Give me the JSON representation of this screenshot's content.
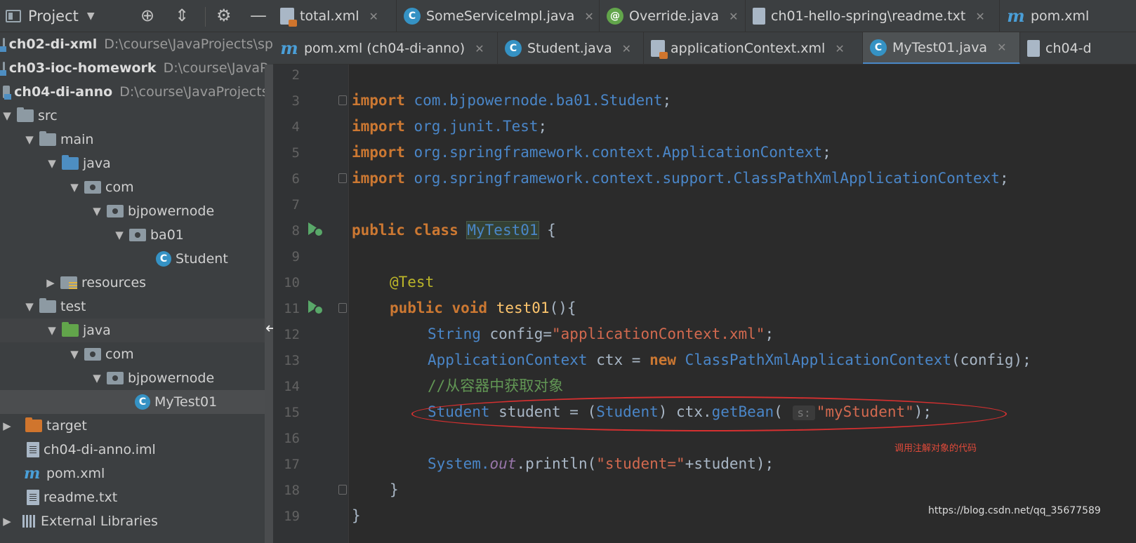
{
  "project_panel": {
    "title": "Project",
    "tree": [
      {
        "label": "ch02-di-xml",
        "path": "D:\\course\\JavaProjects\\sp",
        "icon": "module-icon",
        "indent": 0,
        "bold": true
      },
      {
        "label": "ch03-ioc-homework",
        "path": "D:\\course\\JavaPr",
        "icon": "module-icon",
        "indent": 0,
        "bold": true
      },
      {
        "label": "ch04-di-anno",
        "path": "D:\\course\\JavaProjects\\",
        "icon": "module-icon",
        "indent": 0,
        "bold": true
      },
      {
        "label": "src",
        "icon": "folder-icon",
        "indent": 0
      },
      {
        "label": "main",
        "icon": "folder-icon",
        "indent": 1
      },
      {
        "label": "java",
        "icon": "source-folder-icon",
        "indent": 2
      },
      {
        "label": "com",
        "icon": "package-icon",
        "indent": 3
      },
      {
        "label": "bjpowernode",
        "icon": "package-icon",
        "indent": 4
      },
      {
        "label": "ba01",
        "icon": "package-icon",
        "indent": 5
      },
      {
        "label": "Student",
        "icon": "class-icon",
        "indent": 6
      },
      {
        "label": "resources",
        "icon": "resources-folder-icon",
        "indent": 1
      },
      {
        "label": "test",
        "icon": "folder-icon",
        "indent": 0
      },
      {
        "label": "java",
        "icon": "test-folder-icon",
        "indent": 1
      },
      {
        "label": "com",
        "icon": "package-icon",
        "indent": 2
      },
      {
        "label": "bjpowernode",
        "icon": "package-icon",
        "indent": 3
      },
      {
        "label": "MyTest01",
        "icon": "test-class-icon",
        "indent": 4
      },
      {
        "label": "target",
        "icon": "excluded-folder-icon",
        "indent": 0
      },
      {
        "label": "ch04-di-anno.iml",
        "icon": "iml-file-icon",
        "indent": 0
      },
      {
        "label": "pom.xml",
        "icon": "maven-icon",
        "indent": 0
      },
      {
        "label": "readme.txt",
        "icon": "text-file-icon",
        "indent": 0
      },
      {
        "label": "External Libraries",
        "icon": "libraries-icon",
        "indent": 0
      }
    ]
  },
  "tabs_row1": [
    {
      "label": "total.xml",
      "icon": "xml-icon"
    },
    {
      "label": "SomeServiceImpl.java",
      "icon": "class-icon"
    },
    {
      "label": "Override.java",
      "icon": "annotation-icon"
    },
    {
      "label": "ch01-hello-spring\\readme.txt",
      "icon": "text-file-icon"
    },
    {
      "label": "pom.xml",
      "icon": "maven-icon"
    }
  ],
  "tabs_row2": [
    {
      "label": "pom.xml (ch04-di-anno)",
      "icon": "maven-icon"
    },
    {
      "label": "Student.java",
      "icon": "class-icon"
    },
    {
      "label": "applicationContext.xml",
      "icon": "xml-icon"
    },
    {
      "label": "MyTest01.java",
      "icon": "class-icon",
      "active": true
    },
    {
      "label": "ch04-d",
      "icon": "text-file-icon"
    }
  ],
  "editor": {
    "line_numbers": [
      "2",
      "3",
      "4",
      "5",
      "6",
      "7",
      "8",
      "9",
      "10",
      "11",
      "12",
      "13",
      "14",
      "15",
      "16",
      "17",
      "18",
      "19"
    ],
    "code": {
      "l3_kw": "import",
      "l3_pkg": " com.bjpowernode.ba01.",
      "l3_cls": "Student",
      "l3_end": ";",
      "l4_kw": "import",
      "l4_pkg": " org.junit.",
      "l4_cls": "Test",
      "l4_end": ";",
      "l5_kw": "import",
      "l5_pkg": " org.springframework.context.",
      "l5_cls": "ApplicationContext",
      "l5_end": ";",
      "l6_kw": "import",
      "l6_pkg": " org.springframework.context.support.",
      "l6_cls": "ClassPathXmlApplicationContext",
      "l6_end": ";",
      "l8_kw": "public class ",
      "l8_cls": "MyTest01",
      "l8_end": " {",
      "l10_ann": "@Test",
      "l11_kw": "public void ",
      "l11_fn": "test01",
      "l11_end": "(){",
      "l12_type": "String",
      "l12_a": " config=",
      "l12_str": "\"applicationContext.xml\"",
      "l12_end": ";",
      "l13_type": "ApplicationContext",
      "l13_a": " ctx = ",
      "l13_kw": "new ",
      "l13_type2": "ClassPathXmlApplicationContext",
      "l13_end": "(config);",
      "l14_comment": "//从容器中获取对象",
      "l15_type": "Student",
      "l15_a": " student = (",
      "l15_type2": "Student",
      "l15_b": ") ctx.",
      "l15_fn": "getBean",
      "l15_c": "( ",
      "l15_hint": "s:",
      "l15_str": "\"myStudent\"",
      "l15_end": ");",
      "l17_a": "System.",
      "l17_out": "out",
      "l17_b": ".println(",
      "l17_str": "\"student=\"",
      "l17_end": "+student);",
      "l18": "}",
      "l19": "}"
    }
  },
  "annotation_text": "调用注解对象的代码",
  "watermark": "https://blog.csdn.net/qq_35677589",
  "colors": {
    "keyword": "#cc7832",
    "type": "#4a86c8",
    "string": "#6a8759",
    "comment": "#629755",
    "annotation": "#bbb529",
    "highlight_ellipse": "#d63030"
  }
}
